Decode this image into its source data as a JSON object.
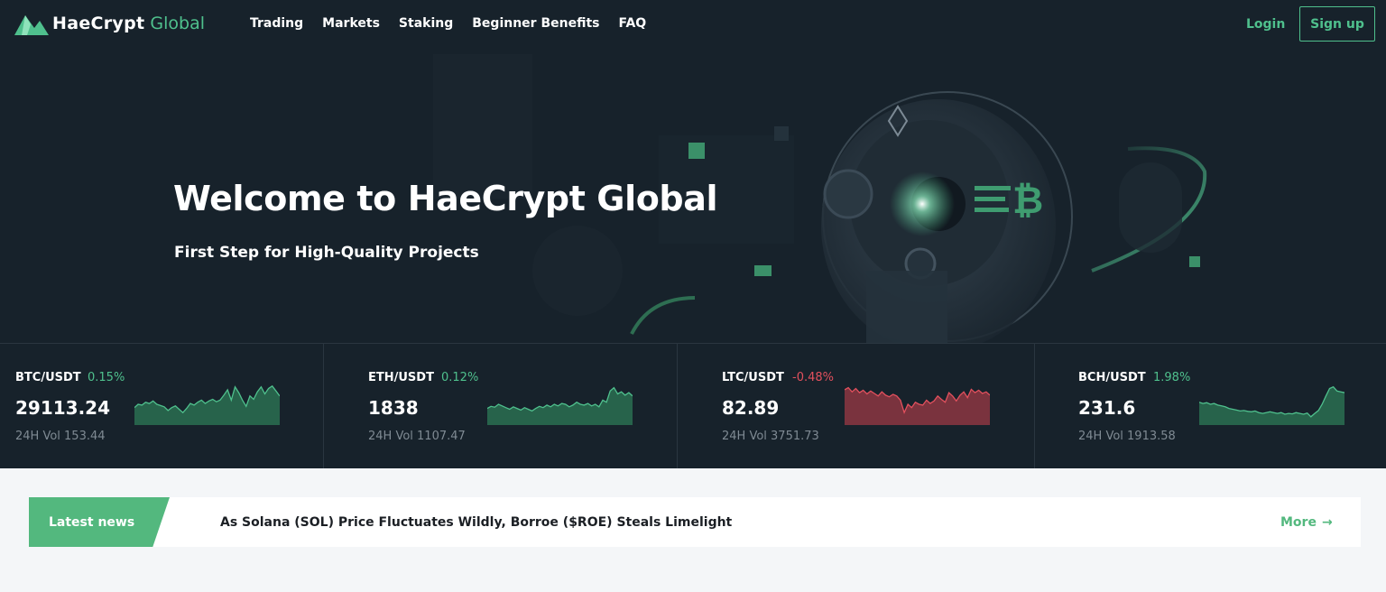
{
  "brand": {
    "name": "HaeCrypt",
    "accent": "Global",
    "accent_color": "#4fc08d"
  },
  "nav": {
    "links": [
      "Trading",
      "Markets",
      "Staking",
      "Beginner Benefits",
      "FAQ"
    ],
    "login": "Login",
    "signup": "Sign up"
  },
  "hero": {
    "title": "Welcome to HaeCrypt Global",
    "subtitle": "First Step for High-Quality Projects"
  },
  "tickers": [
    {
      "pair": "BTC/USDT",
      "change": "0.15%",
      "trend": "up",
      "price": "29113.24",
      "volume": "24H Vol 153.44",
      "spark": [
        0.42,
        0.5,
        0.48,
        0.55,
        0.52,
        0.58,
        0.5,
        0.47,
        0.44,
        0.35,
        0.42,
        0.46,
        0.38,
        0.3,
        0.4,
        0.52,
        0.48,
        0.55,
        0.6,
        0.52,
        0.58,
        0.62,
        0.56,
        0.6,
        0.72,
        0.85,
        0.6,
        0.92,
        0.78,
        0.6,
        0.45,
        0.7,
        0.62,
        0.8,
        0.92,
        0.75,
        0.88,
        0.94,
        0.82,
        0.7
      ]
    },
    {
      "pair": "ETH/USDT",
      "change": "0.12%",
      "trend": "up",
      "price": "1838",
      "volume": "24H Vol 1107.47",
      "spark": [
        0.4,
        0.45,
        0.43,
        0.5,
        0.46,
        0.42,
        0.38,
        0.44,
        0.4,
        0.36,
        0.42,
        0.38,
        0.34,
        0.4,
        0.45,
        0.42,
        0.48,
        0.44,
        0.5,
        0.46,
        0.52,
        0.5,
        0.44,
        0.48,
        0.55,
        0.5,
        0.48,
        0.52,
        0.46,
        0.5,
        0.44,
        0.6,
        0.55,
        0.82,
        0.9,
        0.75,
        0.8,
        0.72,
        0.78,
        0.7
      ]
    },
    {
      "pair": "LTC/USDT",
      "change": "-0.48%",
      "trend": "down",
      "price": "82.89",
      "volume": "24H Vol 3751.73",
      "spark": [
        0.85,
        0.9,
        0.8,
        0.88,
        0.78,
        0.84,
        0.75,
        0.82,
        0.76,
        0.7,
        0.8,
        0.72,
        0.68,
        0.74,
        0.7,
        0.6,
        0.3,
        0.5,
        0.42,
        0.55,
        0.5,
        0.48,
        0.6,
        0.52,
        0.58,
        0.7,
        0.62,
        0.55,
        0.78,
        0.7,
        0.58,
        0.72,
        0.8,
        0.66,
        0.86,
        0.78,
        0.84,
        0.76,
        0.8,
        0.72
      ]
    },
    {
      "pair": "BCH/USDT",
      "change": "1.98%",
      "trend": "up",
      "price": "231.6",
      "volume": "24H Vol 1913.58",
      "spark": [
        0.55,
        0.52,
        0.54,
        0.5,
        0.52,
        0.48,
        0.46,
        0.44,
        0.4,
        0.38,
        0.36,
        0.34,
        0.35,
        0.33,
        0.32,
        0.34,
        0.3,
        0.28,
        0.3,
        0.32,
        0.3,
        0.28,
        0.3,
        0.26,
        0.28,
        0.27,
        0.3,
        0.28,
        0.26,
        0.29,
        0.2,
        0.28,
        0.35,
        0.5,
        0.7,
        0.88,
        0.92,
        0.82,
        0.8,
        0.78
      ]
    }
  ],
  "colors": {
    "up": "#4fc08d",
    "down": "#e2505d",
    "up_fill": "#2e7a57",
    "down_fill": "#9c3a46"
  },
  "news": {
    "tag": "Latest news",
    "headline": "As Solana (SOL) Price Fluctuates Wildly, Borroe ($ROE) Steals Limelight",
    "more": "More",
    "arrow_icon": "→"
  }
}
